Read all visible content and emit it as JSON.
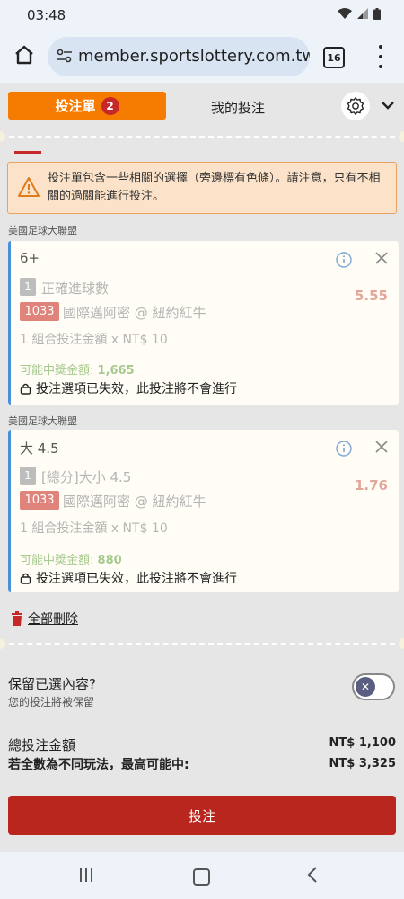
{
  "status_bar": {
    "time": "03:48"
  },
  "browser": {
    "url": "member.sportslottery.com.tw",
    "tab_count": "16"
  },
  "tabs": {
    "betslip_label": "投注單",
    "betslip_count": "2",
    "my_bets_label": "我的投注"
  },
  "notice": {
    "text": "投注單包含一些相關的選擇（旁邊標有色條）。請注意，只有不相關的過關能進行投注。"
  },
  "bets": [
    {
      "league": "美國足球大聯盟",
      "selection": "6+",
      "leg_number": "1",
      "market": "正確進球數",
      "odds": "5.55",
      "match_code": "1033",
      "match": "國際邁阿密 @ 紐約紅牛",
      "stake": "1 組合投注金額 x NT$ 10",
      "payout_label": "可能中獎金額:",
      "payout_value": "1,665",
      "invalid_text": "投注選項已失效，此投注將不會進行"
    },
    {
      "league": "美國足球大聯盟",
      "selection": "大 4.5",
      "leg_number": "1",
      "market": "[總分]大小 4.5",
      "odds": "1.76",
      "match_code": "1033",
      "match": "國際邁阿密 @ 紐約紅牛",
      "stake": "1 組合投注金額 x NT$ 10",
      "payout_label": "可能中獎金額:",
      "payout_value": "880",
      "invalid_text": "投注選項已失效，此投注將不會進行"
    }
  ],
  "delete_all_label": "全部刪除",
  "keep_selections": {
    "title": "保留已選內容?",
    "subtitle": "您的投注將被保留",
    "enabled": false
  },
  "totals": {
    "total_label": "總投注金額",
    "total_value": "NT$ 1,100",
    "max_label": "若全數為不同玩法，最高可能中:",
    "max_value": "NT$ 3,325"
  },
  "place_bet_label": "投注",
  "colors": {
    "accent": "#f57c00",
    "primary_red": "#b8261e",
    "link_blue": "#4a90d9"
  }
}
